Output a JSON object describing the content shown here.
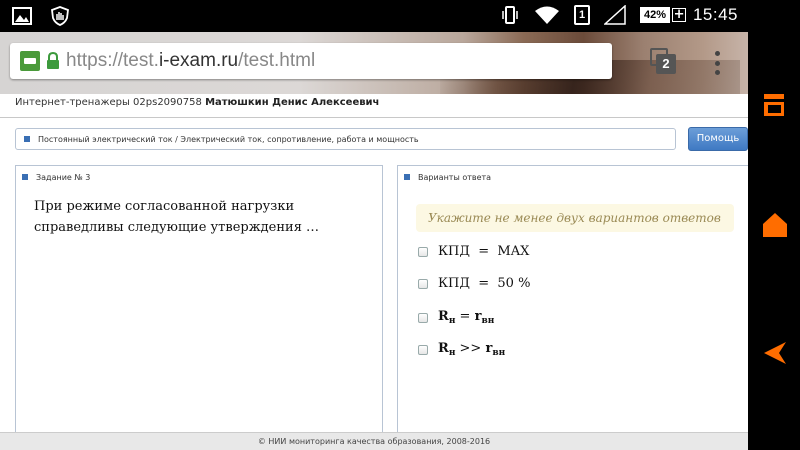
{
  "status_bar": {
    "battery_percent": "42%",
    "battery_plus": "+",
    "sim_slot": "1",
    "time": "15:45",
    "icons": [
      "gallery-icon",
      "shield-hand-icon",
      "vibrate-icon",
      "wifi-icon",
      "sim-icon",
      "signal-icon",
      "battery-icon"
    ]
  },
  "browser": {
    "url_prefix": "https://test.",
    "url_host": "i-exam.ru",
    "url_path": "/test.html",
    "tab_count": "2"
  },
  "page": {
    "user_label": "Интернет-тренажеры 02ps2090758",
    "user_name": "Матюшкин Денис Алексеевич",
    "topic": "Постоянный электрический ток / Электрический ток, сопротивление, работа и мощность",
    "help_button": "Помощь",
    "task_title": "Задание № 3",
    "question": "При режиме согласованной нагрузки справедливы следующие утверждения …",
    "answers_title": "Варианты ответа",
    "hint": "Укажите не менее двух вариантов ответов",
    "options": [
      {
        "text": "КПД  =  MAX"
      },
      {
        "text": "КПД  =  50 %"
      },
      {
        "r": "R",
        "r_sub": "н",
        "op": " = ",
        "r2": "r",
        "r2_sub": "вн"
      },
      {
        "r": "R",
        "r_sub": "н",
        "op": " >> ",
        "r2": "r",
        "r2_sub": "вн"
      }
    ],
    "footer": "© НИИ мониторинга качества образования, 2008-2016"
  },
  "colors": {
    "accent_orange": "#ff6d00",
    "help_button_blue": "#4a82c8",
    "hint_bg": "#fcf8e3"
  }
}
